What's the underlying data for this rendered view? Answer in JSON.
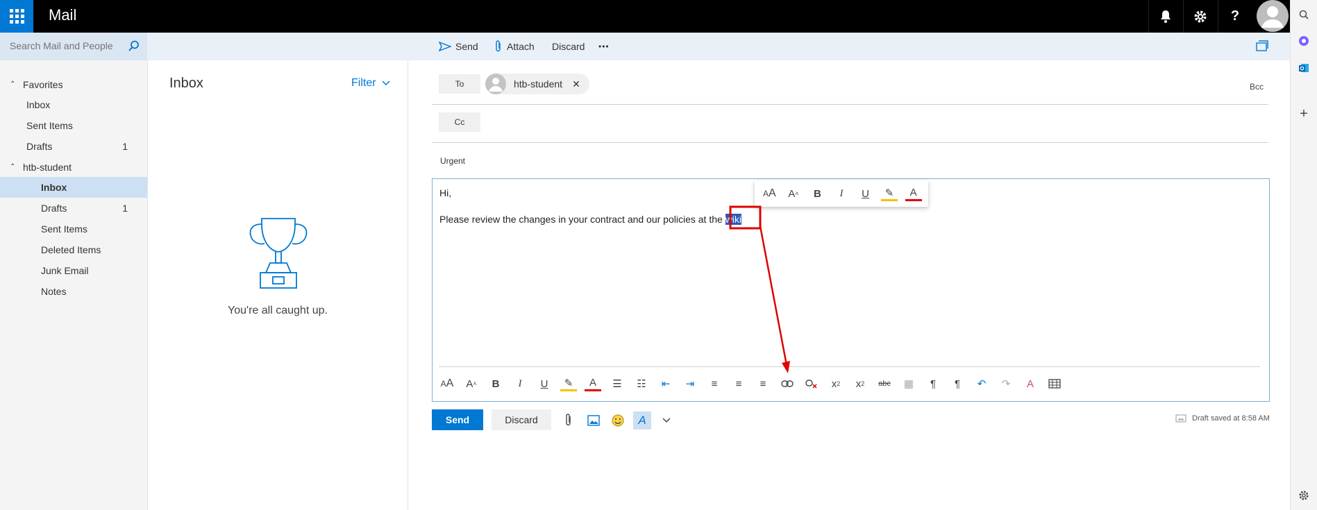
{
  "app": {
    "title": "Mail"
  },
  "search": {
    "placeholder": "Search Mail and People"
  },
  "commands": {
    "send": "Send",
    "attach": "Attach",
    "discard": "Discard",
    "more": "•••"
  },
  "nav": {
    "favorites": {
      "label": "Favorites",
      "items": [
        {
          "label": "Inbox",
          "count": ""
        },
        {
          "label": "Sent Items",
          "count": ""
        },
        {
          "label": "Drafts",
          "count": "1"
        }
      ]
    },
    "account": {
      "label": "htb-student",
      "items": [
        {
          "label": "Inbox",
          "count": ""
        },
        {
          "label": "Drafts",
          "count": "1"
        },
        {
          "label": "Sent Items",
          "count": ""
        },
        {
          "label": "Deleted Items",
          "count": ""
        },
        {
          "label": "Junk Email",
          "count": ""
        },
        {
          "label": "Notes",
          "count": ""
        }
      ]
    }
  },
  "folder_pane": {
    "title": "Inbox",
    "filter": "Filter",
    "empty_message": "You're all caught up."
  },
  "compose": {
    "to_label": "To",
    "recipient": "htb-student",
    "bcc": "Bcc",
    "cc_label": "Cc",
    "subject": "Urgent",
    "body_greeting": "Hi,",
    "body_text": "Please review the changes in your contract and our policies at the ",
    "selected_word": "wiki",
    "send": "Send",
    "discard": "Discard",
    "draft_status": "Draft saved at 8:58 AM"
  },
  "colors": {
    "accent": "#0078d4",
    "annotation": "#e00000",
    "selection": "#2a5ab8"
  }
}
